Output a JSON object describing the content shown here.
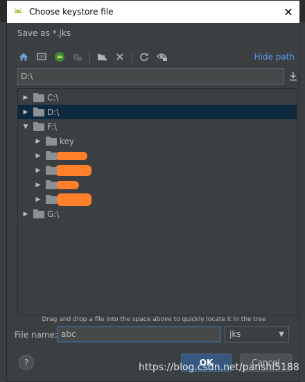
{
  "window": {
    "title": "Choose keystore file",
    "close_glyph": "✕"
  },
  "subtitle": "Save as *.jks",
  "toolbar": {
    "icons": [
      "home-icon",
      "desktop-icon",
      "android-project-icon",
      "module-icon",
      "new-folder-icon",
      "delete-icon",
      "refresh-icon",
      "show-hidden-icon"
    ],
    "hide_path_label": "Hide path"
  },
  "path": {
    "value": "D:\\"
  },
  "tree": {
    "items": [
      {
        "label": "C:\\",
        "expanded": false,
        "selected": false
      },
      {
        "label": "D:\\",
        "expanded": false,
        "selected": true
      },
      {
        "label": "F:\\",
        "expanded": true,
        "selected": false
      },
      {
        "label": "key",
        "expanded": false,
        "selected": false
      },
      {
        "label": "",
        "redacted": true
      },
      {
        "label": "",
        "redacted": true
      },
      {
        "label": "",
        "redacted": true
      },
      {
        "label": "",
        "redacted": true
      },
      {
        "label": "G:\\",
        "expanded": false,
        "selected": false
      }
    ]
  },
  "hint": "Drag and drop a file into the space above to quickly locate it in the tree",
  "file_name": {
    "label": "File name:",
    "value": "abc"
  },
  "file_type": {
    "selected": "jks"
  },
  "buttons": {
    "help": "?",
    "ok": "OK",
    "cancel": "Cancel"
  },
  "watermark": "https://blog.csdn.net/panshi5188",
  "colors": {
    "background": "#3c3f41",
    "selection": "#0d293e",
    "link": "#589df6",
    "ok_button": "#365880",
    "redaction": "#ff7f2a"
  }
}
